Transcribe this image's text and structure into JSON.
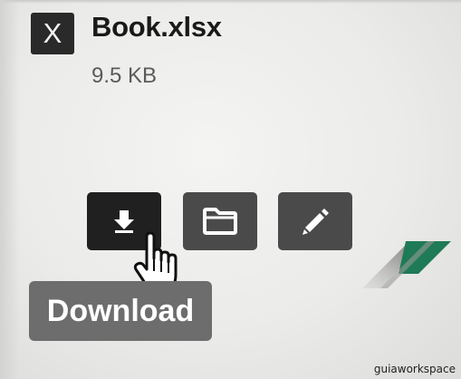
{
  "file": {
    "type_icon_letter": "X",
    "name": "Book.xlsx",
    "size": "9.5 KB"
  },
  "actions": [
    {
      "icon": "download-arrow-icon",
      "state": "hover"
    },
    {
      "icon": "folder-icon",
      "state": "normal"
    },
    {
      "icon": "pencil-icon",
      "state": "normal"
    }
  ],
  "tooltip": {
    "label": "Download"
  },
  "cursor": {
    "icon": "hand-pointer-icon"
  },
  "watermark": {
    "text": "guiaworkspace"
  },
  "colors": {
    "accent_green": "#1f7a58",
    "button_hover": "#202020",
    "button": "#4a4a4a",
    "tooltip_bg": "#6d6d6d"
  }
}
